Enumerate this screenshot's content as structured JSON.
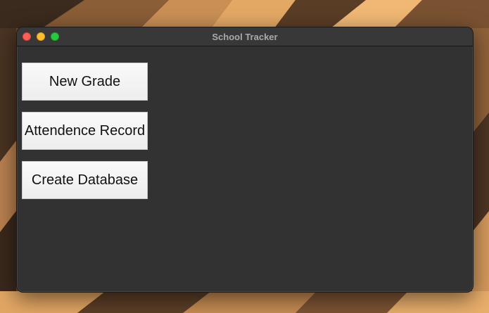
{
  "window": {
    "title": "School Tracker"
  },
  "buttons": {
    "new_grade": "New Grade",
    "attendence_record": "Attendence Record",
    "create_database": "Create Database"
  },
  "colors": {
    "window_bg": "#323232",
    "titlebar_bg": "#383838",
    "title_text": "#a9a9a9",
    "traffic_close": "#ff5f57",
    "traffic_minimize": "#febc2e",
    "traffic_zoom": "#28c840",
    "button_bg": "#f4f4f4",
    "button_text": "#111111"
  }
}
